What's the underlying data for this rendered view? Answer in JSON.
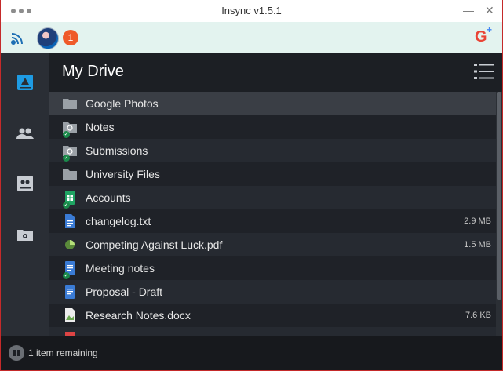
{
  "window": {
    "title": "Insync v1.5.1"
  },
  "toolbar": {
    "notification_count": "1",
    "account_icon": "google-plus-icon",
    "account_label_g": "G",
    "account_label_plus": "+"
  },
  "sidebar": {
    "items": [
      {
        "name": "my-drive",
        "icon": "drive-icon",
        "active": true
      },
      {
        "name": "shared",
        "icon": "people-icon",
        "active": false
      },
      {
        "name": "team-drives",
        "icon": "shared-drive-icon",
        "active": false
      },
      {
        "name": "settings",
        "icon": "folder-gear-icon",
        "active": false
      }
    ]
  },
  "header": {
    "title": "My Drive"
  },
  "files": [
    {
      "name": "Google Photos",
      "size": "",
      "icon": "folder-icon",
      "synced": false,
      "selected": true
    },
    {
      "name": "Notes",
      "size": "",
      "icon": "shared-folder-icon",
      "synced": true
    },
    {
      "name": "Submissions",
      "size": "",
      "icon": "shared-folder-icon",
      "synced": true
    },
    {
      "name": "University Files",
      "size": "",
      "icon": "folder-icon",
      "synced": false
    },
    {
      "name": "Accounts",
      "size": "",
      "icon": "sheets-icon",
      "synced": true
    },
    {
      "name": "changelog.txt",
      "size": "2.9 MB",
      "icon": "doc-file-icon",
      "synced": false
    },
    {
      "name": "Competing Against Luck.pdf",
      "size": "1.5 MB",
      "icon": "progress-pie-icon",
      "synced": false
    },
    {
      "name": "Meeting notes",
      "size": "",
      "icon": "docs-icon",
      "synced": true
    },
    {
      "name": "Proposal - Draft",
      "size": "",
      "icon": "docs-icon",
      "synced": false
    },
    {
      "name": "Research Notes.docx",
      "size": "7.6 KB",
      "icon": "image-file-icon",
      "synced": false
    }
  ],
  "footer": {
    "status": "1 item remaining"
  },
  "colors": {
    "accent": "#1e9be3",
    "check": "#1a8a4a",
    "badge": "#ef5a2a"
  }
}
